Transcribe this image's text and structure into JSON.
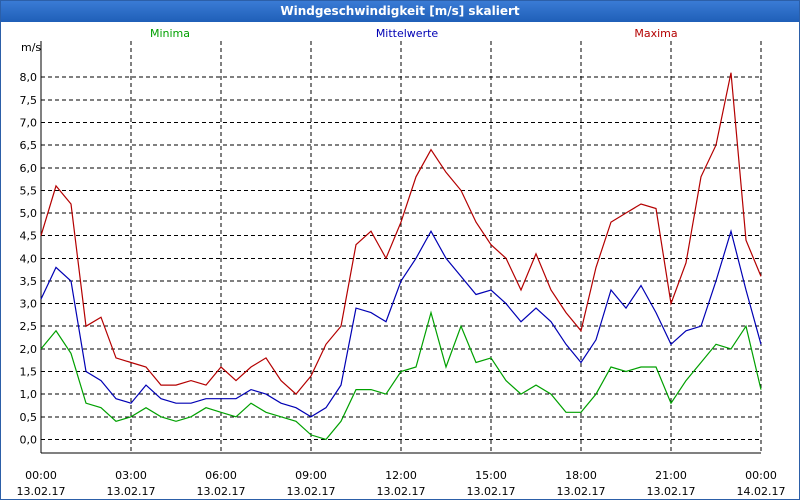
{
  "window": {
    "title": "Windgeschwindigkeit [m/s] skaliert"
  },
  "colors": {
    "minima": "#00a000",
    "mittelwerte": "#0000b4",
    "maxima": "#b40000",
    "grid": "#000000"
  },
  "chart_data": {
    "type": "line",
    "title": "Windgeschwindigkeit [m/s] skaliert",
    "ylabel": "m/s",
    "xlabel": "",
    "ylim": [
      -0.3,
      8.8
    ],
    "xlim": [
      0,
      24
    ],
    "yticks": [
      0.0,
      0.5,
      1.0,
      1.5,
      2.0,
      2.5,
      3.0,
      3.5,
      4.0,
      4.5,
      5.0,
      5.5,
      6.0,
      6.5,
      7.0,
      7.5,
      8.0
    ],
    "ytick_labels": [
      "0,0",
      "0,5",
      "1,0",
      "1,5",
      "2,0",
      "2,5",
      "3,0",
      "3,5",
      "4,0",
      "4,5",
      "5,0",
      "5,5",
      "6,0",
      "6,5",
      "7,0",
      "7,5",
      "8,0"
    ],
    "xticks": [
      0,
      3,
      6,
      9,
      12,
      15,
      18,
      21,
      24
    ],
    "xtick_labels": [
      [
        "00:00",
        "13.02.17"
      ],
      [
        "03:00",
        "13.02.17"
      ],
      [
        "06:00",
        "13.02.17"
      ],
      [
        "09:00",
        "13.02.17"
      ],
      [
        "12:00",
        "13.02.17"
      ],
      [
        "15:00",
        "13.02.17"
      ],
      [
        "18:00",
        "13.02.17"
      ],
      [
        "21:00",
        "13.02.17"
      ],
      [
        "00:00",
        "14.02.17"
      ]
    ],
    "grid": true,
    "legend": "top",
    "series": [
      {
        "name": "Minima",
        "color_key": "minima",
        "x": [
          0,
          0.5,
          1,
          1.5,
          2,
          2.5,
          3,
          3.5,
          4,
          4.5,
          5,
          5.5,
          6,
          6.5,
          7,
          7.5,
          8,
          8.5,
          9,
          9.5,
          10,
          10.5,
          11,
          11.5,
          12,
          12.5,
          13,
          13.5,
          14,
          14.5,
          15,
          15.5,
          16,
          16.5,
          17,
          17.5,
          18,
          18.5,
          19,
          19.5,
          20,
          20.5,
          21,
          21.5,
          22,
          22.5,
          23,
          23.5,
          24
        ],
        "y": [
          2.0,
          2.4,
          1.9,
          0.8,
          0.7,
          0.4,
          0.5,
          0.7,
          0.5,
          0.4,
          0.5,
          0.7,
          0.6,
          0.5,
          0.8,
          0.6,
          0.5,
          0.4,
          0.1,
          0.0,
          0.4,
          1.1,
          1.1,
          1.0,
          1.5,
          1.6,
          2.8,
          1.6,
          2.5,
          1.7,
          1.8,
          1.3,
          1.0,
          1.2,
          1.0,
          0.6,
          0.6,
          1.0,
          1.6,
          1.5,
          1.6,
          1.6,
          0.8,
          1.3,
          1.7,
          2.1,
          2.0,
          2.5,
          1.1
        ]
      },
      {
        "name": "Mittelwerte",
        "color_key": "mittelwerte",
        "x": [
          0,
          0.5,
          1,
          1.5,
          2,
          2.5,
          3,
          3.5,
          4,
          4.5,
          5,
          5.5,
          6,
          6.5,
          7,
          7.5,
          8,
          8.5,
          9,
          9.5,
          10,
          10.5,
          11,
          11.5,
          12,
          12.5,
          13,
          13.5,
          14,
          14.5,
          15,
          15.5,
          16,
          16.5,
          17,
          17.5,
          18,
          18.5,
          19,
          19.5,
          20,
          20.5,
          21,
          21.5,
          22,
          22.5,
          23,
          23.5,
          24
        ],
        "y": [
          3.1,
          3.8,
          3.5,
          1.5,
          1.3,
          0.9,
          0.8,
          1.2,
          0.9,
          0.8,
          0.8,
          0.9,
          0.9,
          0.9,
          1.1,
          1.0,
          0.8,
          0.7,
          0.5,
          0.7,
          1.2,
          2.9,
          2.8,
          2.6,
          3.5,
          4.0,
          4.6,
          4.0,
          3.6,
          3.2,
          3.3,
          3.0,
          2.6,
          2.9,
          2.6,
          2.1,
          1.7,
          2.2,
          3.3,
          2.9,
          3.4,
          2.8,
          2.1,
          2.4,
          2.5,
          3.5,
          4.6,
          3.3,
          2.1
        ]
      },
      {
        "name": "Maxima",
        "color_key": "maxima",
        "x": [
          0,
          0.5,
          1,
          1.5,
          2,
          2.5,
          3,
          3.5,
          4,
          4.5,
          5,
          5.5,
          6,
          6.5,
          7,
          7.5,
          8,
          8.5,
          9,
          9.5,
          10,
          10.5,
          11,
          11.5,
          12,
          12.5,
          13,
          13.5,
          14,
          14.5,
          15,
          15.5,
          16,
          16.5,
          17,
          17.5,
          18,
          18.5,
          19,
          19.5,
          20,
          20.5,
          21,
          21.5,
          22,
          22.5,
          23,
          23.5,
          24
        ],
        "y": [
          4.5,
          5.6,
          5.2,
          2.5,
          2.7,
          1.8,
          1.7,
          1.6,
          1.2,
          1.2,
          1.3,
          1.2,
          1.6,
          1.3,
          1.6,
          1.8,
          1.3,
          1.0,
          1.4,
          2.1,
          2.5,
          4.3,
          4.6,
          4.0,
          4.8,
          5.8,
          6.4,
          5.9,
          5.5,
          4.8,
          4.3,
          4.0,
          3.3,
          4.1,
          3.3,
          2.8,
          2.4,
          3.8,
          4.8,
          5.0,
          5.2,
          5.1,
          3.0,
          3.9,
          5.8,
          6.5,
          8.1,
          4.4,
          3.6
        ]
      }
    ]
  }
}
